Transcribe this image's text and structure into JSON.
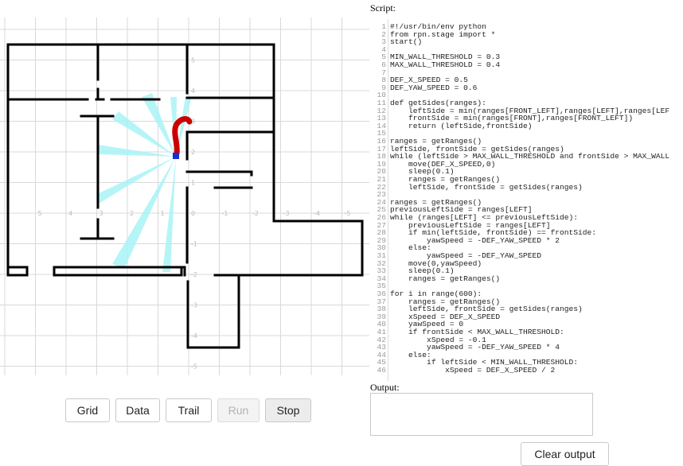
{
  "sim": {
    "axis_labels_x": [
      "5",
      "4",
      "3",
      "2",
      "1",
      "0",
      "-1",
      "-2",
      "-3",
      "-4",
      "-5"
    ],
    "axis_labels_y": [
      "5",
      "4",
      "3",
      "2",
      "1",
      "-1",
      "-2",
      "-3",
      "-4",
      "-5",
      "-6"
    ]
  },
  "buttons": {
    "grid": "Grid",
    "data": "Data",
    "trail": "Trail",
    "run": "Run",
    "stop": "Stop"
  },
  "script_panel": {
    "label": "Script:",
    "lines": [
      "#!/usr/bin/env python",
      "from rpn.stage import *",
      "start()",
      "",
      "MIN_WALL_THRESHOLD = 0.3",
      "MAX_WALL_THRESHOLD = 0.4",
      "",
      "DEF_X_SPEED = 0.5",
      "DEF_YAW_SPEED = 0.6",
      "",
      "def getSides(ranges):",
      "    leftSide = min(ranges[FRONT_LEFT],ranges[LEFT],ranges[LEF",
      "    frontSide = min(ranges[FRONT],ranges[FRONT_LEFT])",
      "    return (leftSide,frontSide)",
      "",
      "ranges = getRanges()",
      "leftSide, frontSide = getSides(ranges)",
      "while (leftSide > MAX_WALL_THRESHOLD and frontSide > MAX_WALL",
      "    move(DEF_X_SPEED,0)",
      "    sleep(0.1)",
      "    ranges = getRanges()",
      "    leftSide, frontSide = getSides(ranges)",
      "",
      "ranges = getRanges()",
      "previousLeftSide = ranges[LEFT]",
      "while (ranges[LEFT] <= previousLeftSide):",
      "    previousLeftSide = ranges[LEFT]",
      "    if min(leftSide, frontSide) == frontSide:",
      "        yawSpeed = -DEF_YAW_SPEED * 2",
      "    else:",
      "        yawSpeed = -DEF_YAW_SPEED",
      "    move(0,yawSpeed)",
      "    sleep(0.1)",
      "    ranges = getRanges()",
      "",
      "for i in range(600):",
      "    ranges = getRanges()",
      "    leftSide, frontSide = getSides(ranges)",
      "    xSpeed = DEF_X_SPEED",
      "    yawSpeed = 0",
      "    if frontSide < MAX_WALL_THRESHOLD:",
      "        xSpeed = -0.1",
      "        yawSpeed = -DEF_YAW_SPEED * 4",
      "    else:",
      "        if leftSide < MIN_WALL_THRESHOLD:",
      "            xSpeed = DEF_X_SPEED / 2"
    ]
  },
  "output_panel": {
    "label": "Output:",
    "value": ""
  },
  "clear_output_label": "Clear output",
  "colors": {
    "wall": "#000000",
    "grid": "#d9d9d9",
    "laser": "#aaf4f6",
    "trail": "#cc0000",
    "robot": "#1a2fd0"
  }
}
